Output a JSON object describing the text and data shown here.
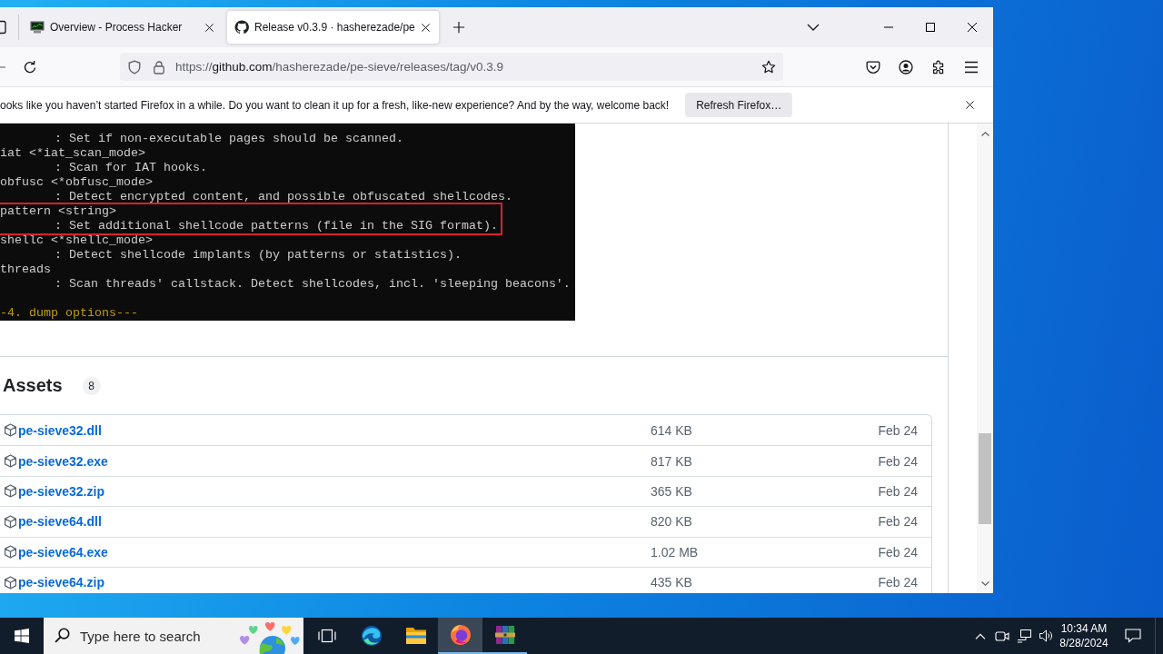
{
  "browser": {
    "tabs": [
      {
        "label": "Overview - Process Hacker",
        "kind": "program",
        "selected": false
      },
      {
        "label": "Release v0.3.9 · hasherezade/pe",
        "kind": "web",
        "selected": true
      }
    ],
    "address": {
      "scheme": "https://",
      "host": "github.com",
      "path": "/hasherezade/pe-sieve/releases/tag/v0.3.9"
    },
    "notification": {
      "message": "ooks like you haven’t started Firefox in a while. Do you want to clean it up for a fresh, like-new experience? And by the way, welcome back!",
      "button": "Refresh Firefox…"
    }
  },
  "terminal": {
    "lines": [
      {
        "kind": "description",
        "text": ": Set if non-executable pages should be scanned.",
        "highlighted": false
      },
      {
        "kind": "option",
        "text": "iat <*iat_scan_mode>",
        "highlighted": false
      },
      {
        "kind": "description",
        "text": ": Scan for IAT hooks.",
        "highlighted": false
      },
      {
        "kind": "option",
        "text": "obfusc <*obfusc_mode>",
        "highlighted": false
      },
      {
        "kind": "description",
        "text": ": Detect encrypted content, and possible obfuscated shellcodes.",
        "highlighted": false
      },
      {
        "kind": "option",
        "text": "pattern <string>",
        "highlighted": true
      },
      {
        "kind": "description",
        "text": ": Set additional shellcode patterns (file in the SIG format).",
        "highlighted": true
      },
      {
        "kind": "option",
        "text": "shellc <*shellc_mode>",
        "highlighted": false
      },
      {
        "kind": "description",
        "text": ": Detect shellcode implants (by patterns or statistics).",
        "highlighted": false
      },
      {
        "kind": "option",
        "text": "threads",
        "highlighted": false
      },
      {
        "kind": "description",
        "text": ": Scan threads' callstack. Detect shellcodes, incl. 'sleeping beacons'.",
        "highlighted": false
      },
      {
        "kind": "section",
        "text": "-4. dump options---",
        "highlighted": false
      }
    ]
  },
  "assets": {
    "title": "Assets",
    "count": "8",
    "rows": [
      {
        "name": "pe-sieve32.dll",
        "size": "614 KB",
        "date": "Feb 24"
      },
      {
        "name": "pe-sieve32.exe",
        "size": "817 KB",
        "date": "Feb 24"
      },
      {
        "name": "pe-sieve32.zip",
        "size": "365 KB",
        "date": "Feb 24"
      },
      {
        "name": "pe-sieve64.dll",
        "size": "820 KB",
        "date": "Feb 24"
      },
      {
        "name": "pe-sieve64.exe",
        "size": "1.02 MB",
        "date": "Feb 24"
      },
      {
        "name": "pe-sieve64.zip",
        "size": "435 KB",
        "date": "Feb 24"
      }
    ]
  },
  "taskbar": {
    "search_placeholder": "Type here to search",
    "apps": [
      {
        "kind": "taskview",
        "running": false,
        "active": false
      },
      {
        "kind": "edge",
        "running": false,
        "active": false
      },
      {
        "kind": "explorer",
        "running": false,
        "active": false
      },
      {
        "kind": "firefox",
        "running": true,
        "active": true
      },
      {
        "kind": "winrar",
        "running": true,
        "active": false
      }
    ],
    "clock": {
      "time": "10:34 AM",
      "date": "8/28/2024"
    }
  }
}
